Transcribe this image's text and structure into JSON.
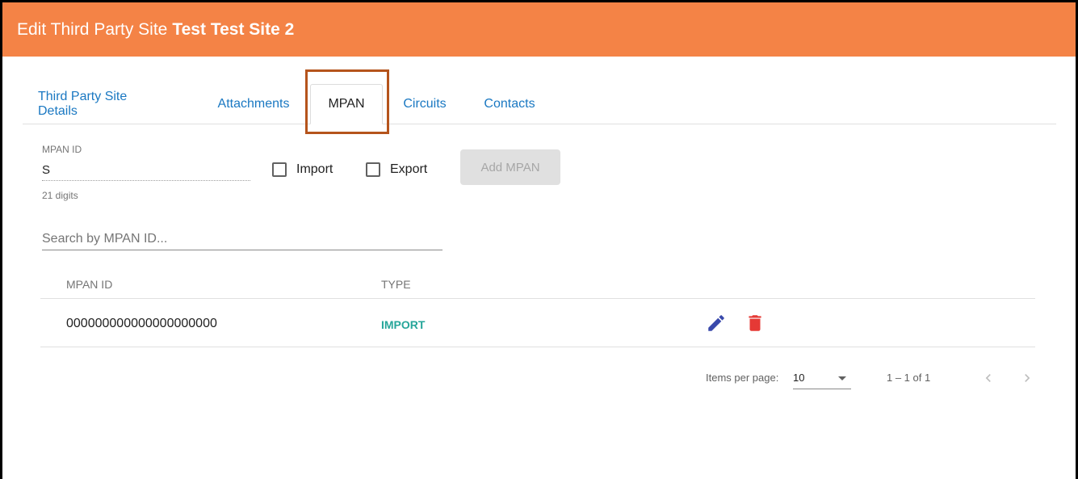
{
  "header": {
    "title_prefix": "Edit Third Party Site",
    "site_name": "Test Test Site 2",
    "background_color": "#f48346"
  },
  "tabs": [
    {
      "label": "Third Party Site Details",
      "active": false
    },
    {
      "label": "Attachments",
      "active": false
    },
    {
      "label": "MPAN",
      "active": true
    },
    {
      "label": "Circuits",
      "active": false
    },
    {
      "label": "Contacts",
      "active": false
    }
  ],
  "form": {
    "mpan_label": "MPAN ID",
    "mpan_value": "S",
    "mpan_hint": "21 digits",
    "import_label": "Import",
    "import_checked": false,
    "export_label": "Export",
    "export_checked": false,
    "add_button_label": "Add MPAN"
  },
  "search": {
    "placeholder": "Search by MPAN ID..."
  },
  "table": {
    "columns": [
      "MPAN ID",
      "TYPE"
    ],
    "rows": [
      {
        "mpan_id": "000000000000000000000",
        "type": "IMPORT",
        "actions": [
          "edit-icon",
          "delete-icon"
        ]
      }
    ]
  },
  "paginator": {
    "items_per_page_label": "Items per page:",
    "items_per_page_value": "10",
    "range_label": "1 – 1 of 1"
  },
  "colors": {
    "link": "#1a78c2",
    "import_type": "#26a69a",
    "edit_icon": "#3949ab",
    "delete_icon": "#e53935",
    "highlight": "#b5541c"
  }
}
